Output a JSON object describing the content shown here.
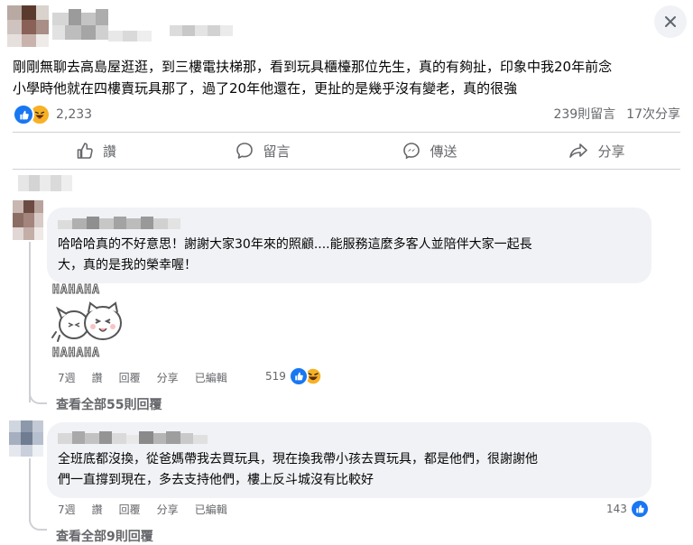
{
  "post": {
    "text_line1": "剛剛無聊去高島屋逛逛，到三樓電扶梯那，看到玩具櫃檯那位先生，真的有夠扯，印象中我20年前念",
    "text_line2": "小學時他就在四樓賣玩具那了，過了20年他還在，更扯的是幾乎沒有變老，真的很強",
    "reaction_count": "2,233",
    "comment_count": "239則留言",
    "share_count": "17次分享"
  },
  "actions": [
    {
      "label": "讚",
      "icon": "like-icon"
    },
    {
      "label": "留言",
      "icon": "comment-icon"
    },
    {
      "label": "傳送",
      "icon": "messenger-icon"
    },
    {
      "label": "分享",
      "icon": "share-icon"
    }
  ],
  "comments": [
    {
      "text_line1": "哈哈哈真的不好意思！謝謝大家30年來的照顧....能服務這麼多客人並陪伴大家一起長",
      "text_line2": "大，真的是我的榮幸喔！",
      "sticker_text_top": "HAHAHA",
      "sticker_text_bottom": "HAHAHA",
      "time": "7週",
      "like": "讚",
      "reply": "回覆",
      "share": "分享",
      "edited": "已編輯",
      "reaction_count": "519",
      "view_replies": "查看全部55則回覆"
    },
    {
      "text_line1": "全班底都沒換，從爸媽帶我去買玩具，現在換我帶小孩去買玩具，都是他們，很謝謝他",
      "text_line2": "們一直撐到現在，多去支持他們，樓上反斗城沒有比較好",
      "time": "7週",
      "like": "讚",
      "reply": "回覆",
      "share": "分享",
      "edited": "已編輯",
      "reaction_count": "143",
      "view_replies": "查看全部9則回覆"
    }
  ],
  "colors": {
    "like_blue": "#1877f2",
    "haha_yellow": "#f7b125",
    "secondary_text": "#65676b",
    "bubble_bg": "#f0f2f5"
  }
}
